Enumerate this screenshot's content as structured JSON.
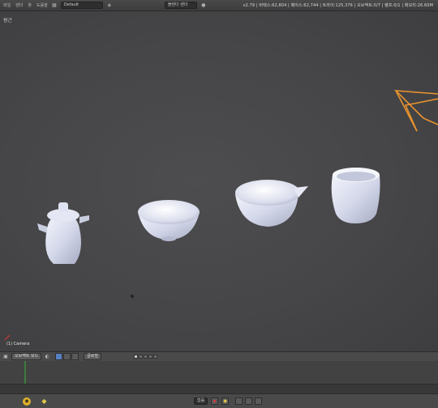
{
  "topbar": {
    "menu": [
      "파일",
      "렌더",
      "창",
      "도움말"
    ],
    "scene_field": "Default",
    "render_engine": "블렌더 렌더",
    "icons": [
      "layout-icon",
      "scene-icon",
      "engine-icon"
    ],
    "stats": "v2.79 | 버텍스:62,804 | 페이스:62,744 | 트라이:125,376 | 오브젝트:0/7 | 램프:0/1 | 메모리:26.60M"
  },
  "viewport": {
    "view_label": "원근",
    "object_label": "(1) Camera",
    "objects": [
      {
        "name": "teapot",
        "icon": "teapot-mesh"
      },
      {
        "name": "shallow-bowl",
        "icon": "bowl-mesh"
      },
      {
        "name": "spouted-bowl",
        "icon": "spouted-bowl-mesh"
      },
      {
        "name": "cup",
        "icon": "cup-mesh"
      }
    ],
    "camera": {
      "icon": "camera-wireframe",
      "color": "#e8922e"
    }
  },
  "vp_header": {
    "view_menu": "보기",
    "mode": "오브젝트 모드",
    "orientation": "글로벌",
    "pivot_active_color": "#5680c2"
  },
  "timeline_header": {
    "keying_set": "없음"
  },
  "colors": {
    "viewport_bg": "#474749",
    "mesh": "#d4d8ea",
    "camera": "#e8922e",
    "logo": "#e2b22c"
  }
}
